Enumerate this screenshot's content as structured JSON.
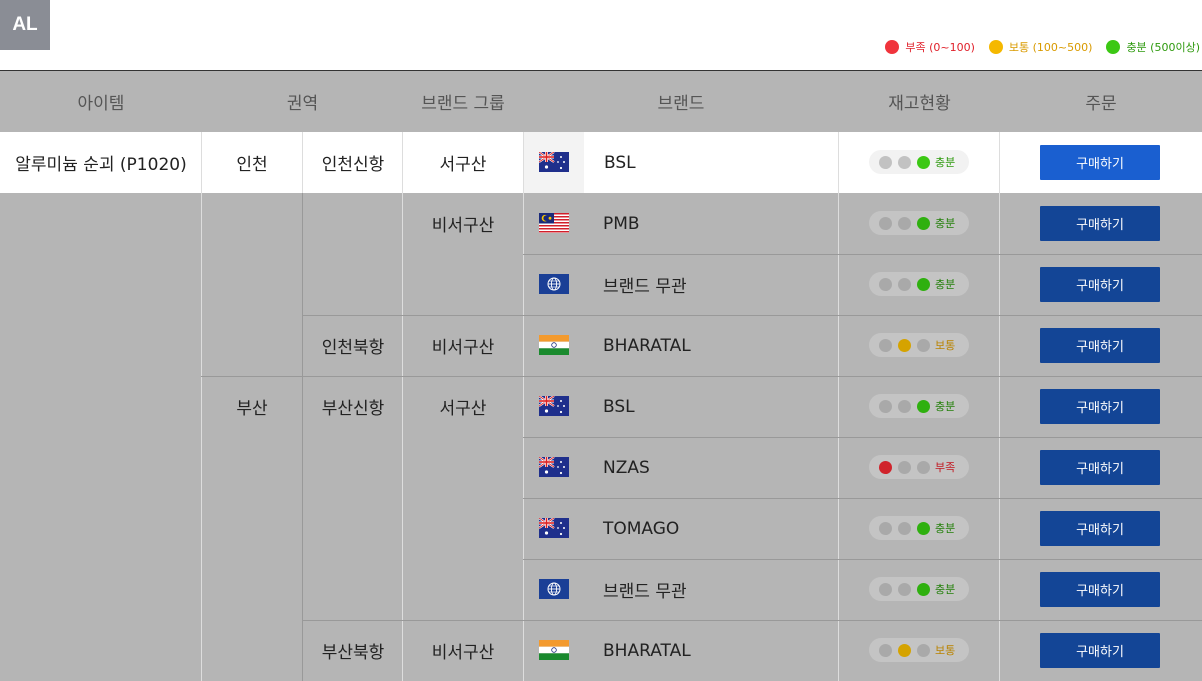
{
  "logo": "AL",
  "legend": [
    {
      "label": "부족 (0~100)",
      "color": "#f0343c"
    },
    {
      "label": "보통 (100~500)",
      "color": "#f5b800"
    },
    {
      "label": "충분 (500이상)",
      "color": "#3cc814"
    }
  ],
  "headers": [
    "아이템",
    "권역",
    "브랜드 그룹",
    "브랜드",
    "재고현황",
    "주문"
  ],
  "item": "알루미늄 순괴 (P1020)",
  "regions": [
    "인천",
    "부산"
  ],
  "ports": [
    "인천신항",
    "인천북항",
    "부산신항",
    "부산북항"
  ],
  "groups": [
    "서구산",
    "비서구산",
    "비서구산",
    "서구산",
    "비서구산"
  ],
  "rows": [
    {
      "flag": "au-flag-icon",
      "brand": "BSL",
      "stock_level": "high",
      "stock_label": "충분"
    },
    {
      "flag": "my-flag-icon",
      "brand": "PMB",
      "stock_level": "high",
      "stock_label": "충분"
    },
    {
      "flag": "globe-flag-icon",
      "brand": "브랜드 무관",
      "stock_level": "high",
      "stock_label": "충분"
    },
    {
      "flag": "in-flag-icon",
      "brand": "BHARATAL",
      "stock_level": "medium",
      "stock_label": "보통"
    },
    {
      "flag": "au-flag-icon",
      "brand": "BSL",
      "stock_level": "high",
      "stock_label": "충분"
    },
    {
      "flag": "au-flag-icon",
      "brand": "NZAS",
      "stock_level": "low",
      "stock_label": "부족"
    },
    {
      "flag": "au-flag-icon",
      "brand": "TOMAGO",
      "stock_level": "high",
      "stock_label": "충분"
    },
    {
      "flag": "globe-flag-icon",
      "brand": "브랜드 무관",
      "stock_level": "high",
      "stock_label": "충분"
    },
    {
      "flag": "in-flag-icon",
      "brand": "BHARATAL",
      "stock_level": "medium",
      "stock_label": "보통"
    }
  ],
  "buy_label": "구매하기",
  "colors": {
    "buy_active": "#1a5fd0",
    "buy_dim": "#134596",
    "low": "#f0343c",
    "medium": "#f5b800",
    "high": "#3cc814",
    "overlay_grey": "#b5b5b5"
  }
}
